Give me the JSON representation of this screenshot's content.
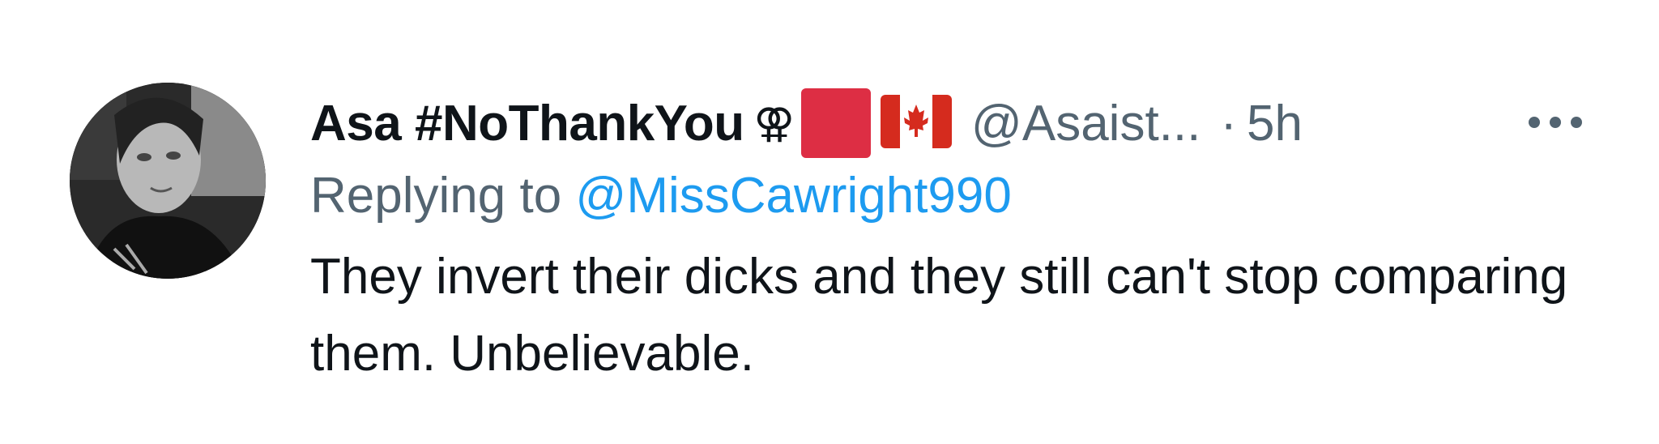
{
  "tweet": {
    "display_name": "Asa #NoThankYou",
    "badge_symbol": "⚢",
    "handle": "@Asaist...",
    "separator": "·",
    "time": "5h",
    "reply_prefix": "Replying to",
    "reply_to": "@MissCawright990",
    "text": "They invert their dicks and they still can't stop comparing them. Unbelievable.",
    "more_icon": "more-horizontal-icon"
  },
  "colors": {
    "text_primary": "#0f1419",
    "text_secondary": "#536471",
    "link": "#1d9bf0",
    "red_square": "#dd2e44",
    "flag_red": "#d52b1e"
  }
}
